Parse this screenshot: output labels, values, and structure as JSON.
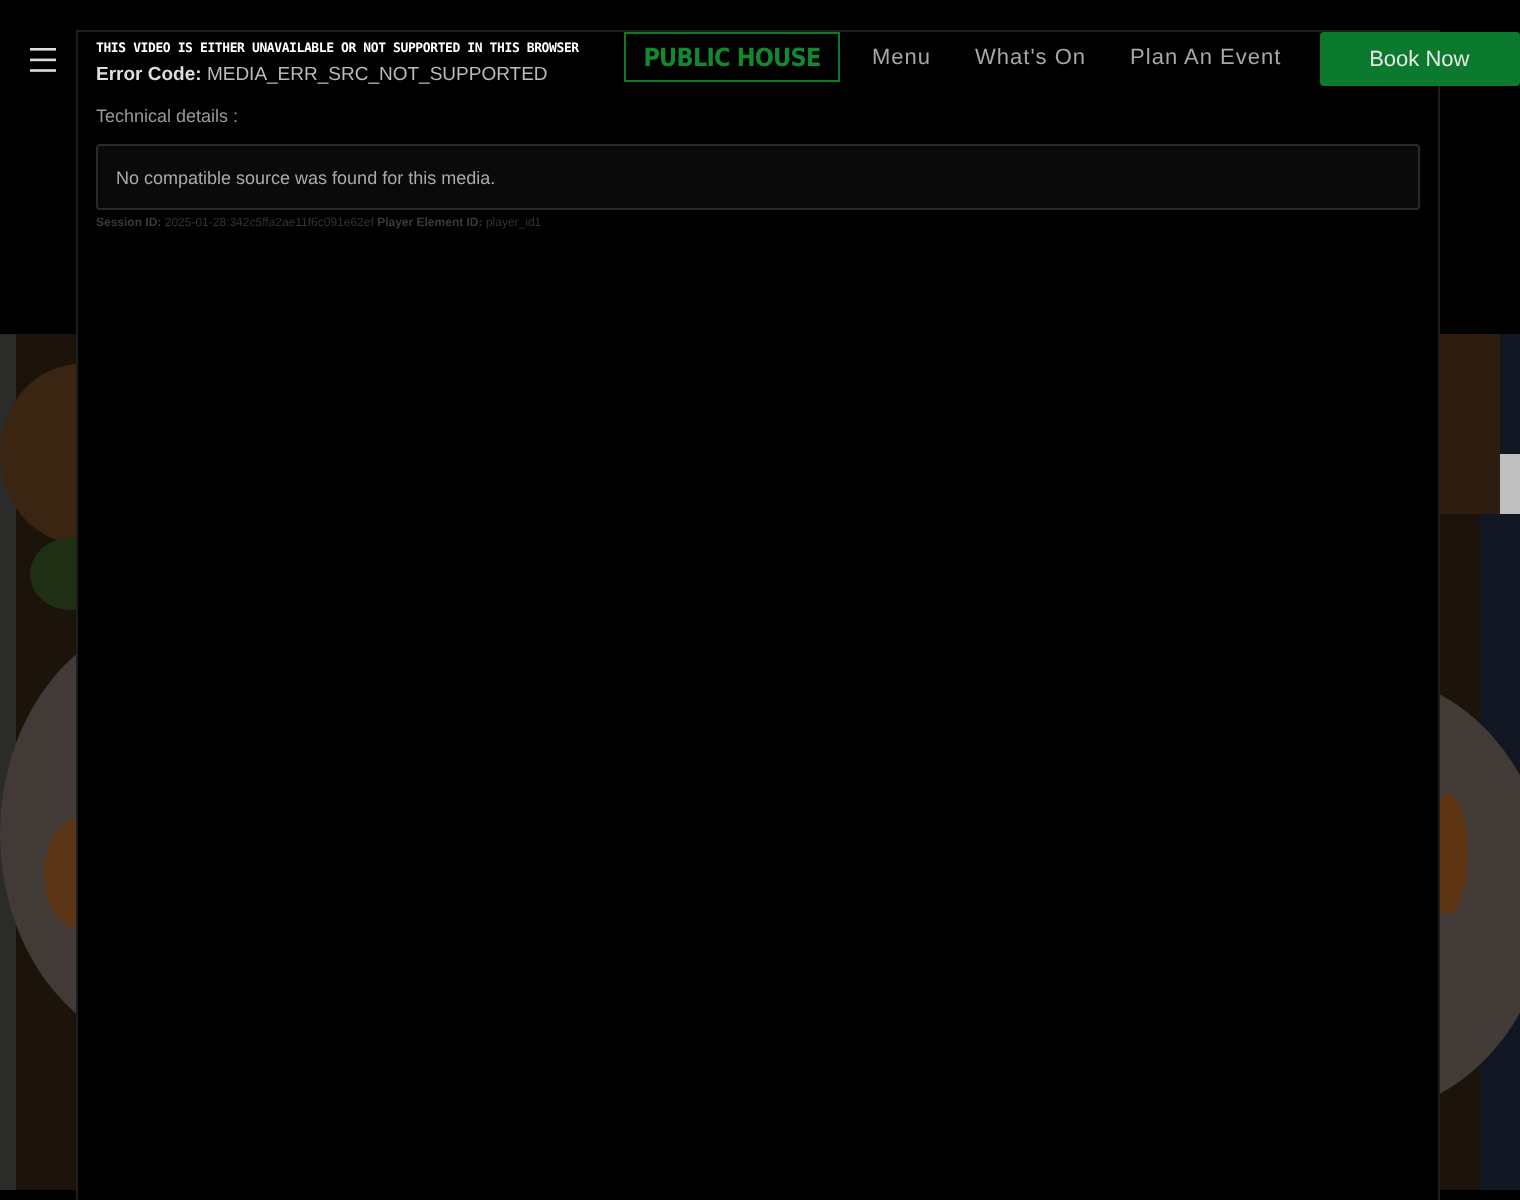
{
  "header": {
    "logo": "PUBLIC HOUSE",
    "nav": [
      {
        "label": "Menu"
      },
      {
        "label": "What's On"
      },
      {
        "label": "Plan An Event"
      }
    ],
    "book_button": "Book Now"
  },
  "video_error": {
    "title": "THIS VIDEO IS EITHER UNAVAILABLE OR NOT SUPPORTED IN THIS BROWSER",
    "error_code_label": "Error Code:",
    "error_code": "MEDIA_ERR_SRC_NOT_SUPPORTED",
    "technical_details": "Technical details :",
    "message": "No compatible source was found for this media.",
    "session_label": "Session ID:",
    "session_id": "2025-01-28:342c5ffa2ae11f6c091e62ef",
    "player_label": "Player Element ID:",
    "player_id": "player_id1"
  }
}
